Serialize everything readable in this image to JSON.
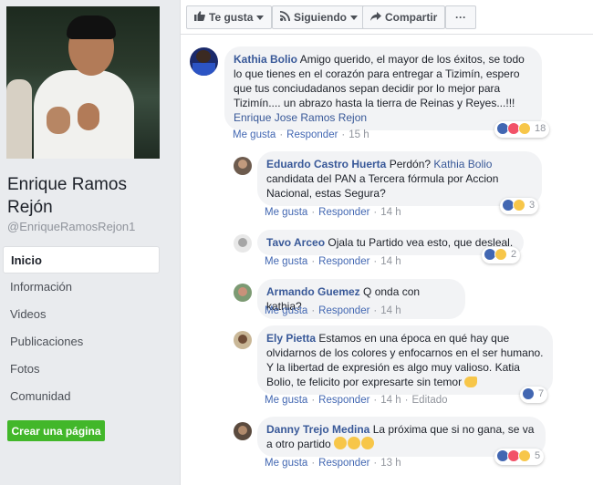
{
  "page": {
    "name": "Enrique Ramos Rejón",
    "handle": "@EnriqueRamosRejon1"
  },
  "nav": {
    "items": [
      "Inicio",
      "Información",
      "Videos",
      "Publicaciones",
      "Fotos",
      "Comunidad"
    ],
    "create_label": "Crear una página"
  },
  "actions": {
    "like": "Te gusta",
    "follow": "Siguiendo",
    "share": "Compartir",
    "more": "···"
  },
  "comments": [
    {
      "author": "Kathia Bolio",
      "text": "Amigo querido, el mayor de los éxitos, se todo lo que tienes en el corazón para entregar a Tizimín, espero que tus conciudadanos sepan decidir por lo mejor para Tizimín.... un abrazo hasta la tierra de Reinas y Reyes...!!! ",
      "mention": "Enrique Jose Ramos Rejon",
      "like": "Me gusta",
      "reply": "Responder",
      "time": "15 h",
      "reactions": "18"
    },
    {
      "author": "Eduardo Castro Huerta",
      "text_pre": "Perdón? ",
      "mention": "Kathia Bolio",
      "text": " candidata del PAN a Tercera fórmula por Accion Nacional, estas Segura?",
      "like": "Me gusta",
      "reply": "Responder",
      "time": "14 h",
      "reactions": "3"
    },
    {
      "author": "Tavo Arceo",
      "text": "Ojala tu Partido vea esto, que desleal.",
      "like": "Me gusta",
      "reply": "Responder",
      "time": "14 h",
      "reactions": "2"
    },
    {
      "author": "Armando Guemez",
      "text": "Q onda con kathia?",
      "like": "Me gusta",
      "reply": "Responder",
      "time": "14 h"
    },
    {
      "author": "Ely Pietta",
      "text": "Estamos en una época en qué hay que olvidarnos de los colores y enfocarnos en el ser humano. Y la libertad de expresión es algo muy valioso. Katia Bolio, te felicito por expresarte sin temor",
      "like": "Me gusta",
      "reply": "Responder",
      "time": "14 h",
      "edited": "Editado",
      "reactions": "7"
    },
    {
      "author": "Danny Trejo Medina",
      "text": "La próxima que si no gana, se va a otro partido",
      "like": "Me gusta",
      "reply": "Responder",
      "time": "13 h",
      "reactions": "5"
    }
  ]
}
